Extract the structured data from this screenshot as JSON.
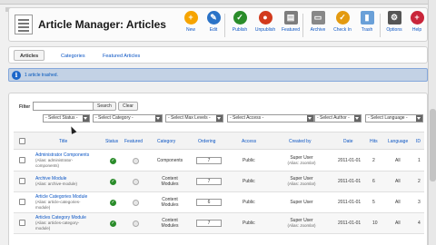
{
  "header": {
    "title": "Article Manager: Articles"
  },
  "toolbar": {
    "buttons": [
      {
        "label": "New",
        "icon": "plus-icon",
        "color": "#f6a400"
      },
      {
        "label": "Edit",
        "icon": "edit-icon",
        "color": "#2b73c7"
      },
      {
        "label": "Publish",
        "icon": "check-icon",
        "color": "#2a8c2a"
      },
      {
        "label": "Unpublish",
        "icon": "stop-icon",
        "color": "#d23a1d"
      },
      {
        "label": "Featured",
        "icon": "featured-icon",
        "color": "#7d7d7d"
      },
      {
        "label": "Archive",
        "icon": "archive-icon",
        "color": "#888888"
      },
      {
        "label": "Check In",
        "icon": "checkin-icon",
        "color": "#e39a11"
      },
      {
        "label": "Trash",
        "icon": "trash-icon",
        "color": "#6aa0d8"
      },
      {
        "label": "Options",
        "icon": "options-icon",
        "color": "#555555"
      },
      {
        "label": "Help",
        "icon": "help-icon",
        "color": "#c9253a"
      }
    ]
  },
  "subnav": {
    "tabs": [
      "Articles",
      "Categories",
      "Featured Articles"
    ],
    "active": "Articles"
  },
  "message": {
    "text": "1 article trashed."
  },
  "filters": {
    "label": "Filter",
    "search_value": "",
    "search_button": "Search",
    "clear_button": "Clear",
    "selects": [
      "- Select Status -",
      "- Select Category -",
      "- Select Max Levels -",
      "- Select Access -",
      "- Select Author -",
      "- Select Language -"
    ]
  },
  "table": {
    "headers": {
      "title": "Title",
      "status": "Status",
      "featured": "Featured",
      "category": "Category",
      "ordering": "Ordering",
      "access": "Access",
      "created_by": "Created by",
      "date": "Date",
      "hits": "Hits",
      "language": "Language",
      "id": "ID"
    },
    "rows": [
      {
        "title": "Administrator Components",
        "alias1": "(Alias: administrator-",
        "alias2": "components)",
        "cat1": "Components",
        "cat2": "",
        "ordering": "7",
        "access": "Public",
        "creator1": "Super User",
        "creator2": "(Alias: Joomla!)",
        "date": "2011-01-01",
        "hits": "2",
        "language": "All",
        "id": "1"
      },
      {
        "title": "Archive Module",
        "alias1": "(Alias: archive-module)",
        "alias2": "",
        "cat1": "Content",
        "cat2": "Modules",
        "ordering": "7",
        "access": "Public",
        "creator1": "Super User",
        "creator2": "(Alias: Joomla!)",
        "date": "2011-01-01",
        "hits": "6",
        "language": "All",
        "id": "2"
      },
      {
        "title": "Article Categories Module",
        "alias1": "(Alias: article-categories-",
        "alias2": "module)",
        "cat1": "Content",
        "cat2": "Modules",
        "ordering": "6",
        "access": "Public",
        "creator1": "Super User",
        "creator2": "",
        "date": "2011-01-01",
        "hits": "5",
        "language": "All",
        "id": "3"
      },
      {
        "title": "Articles Category Module",
        "alias1": "(Alias: articles-category-",
        "alias2": "module)",
        "cat1": "Content",
        "cat2": "Modules",
        "ordering": "7",
        "access": "Public",
        "creator1": "Super User",
        "creator2": "(Alias: Joomla!)",
        "date": "2011-01-01",
        "hits": "10",
        "language": "All",
        "id": "4"
      }
    ]
  }
}
